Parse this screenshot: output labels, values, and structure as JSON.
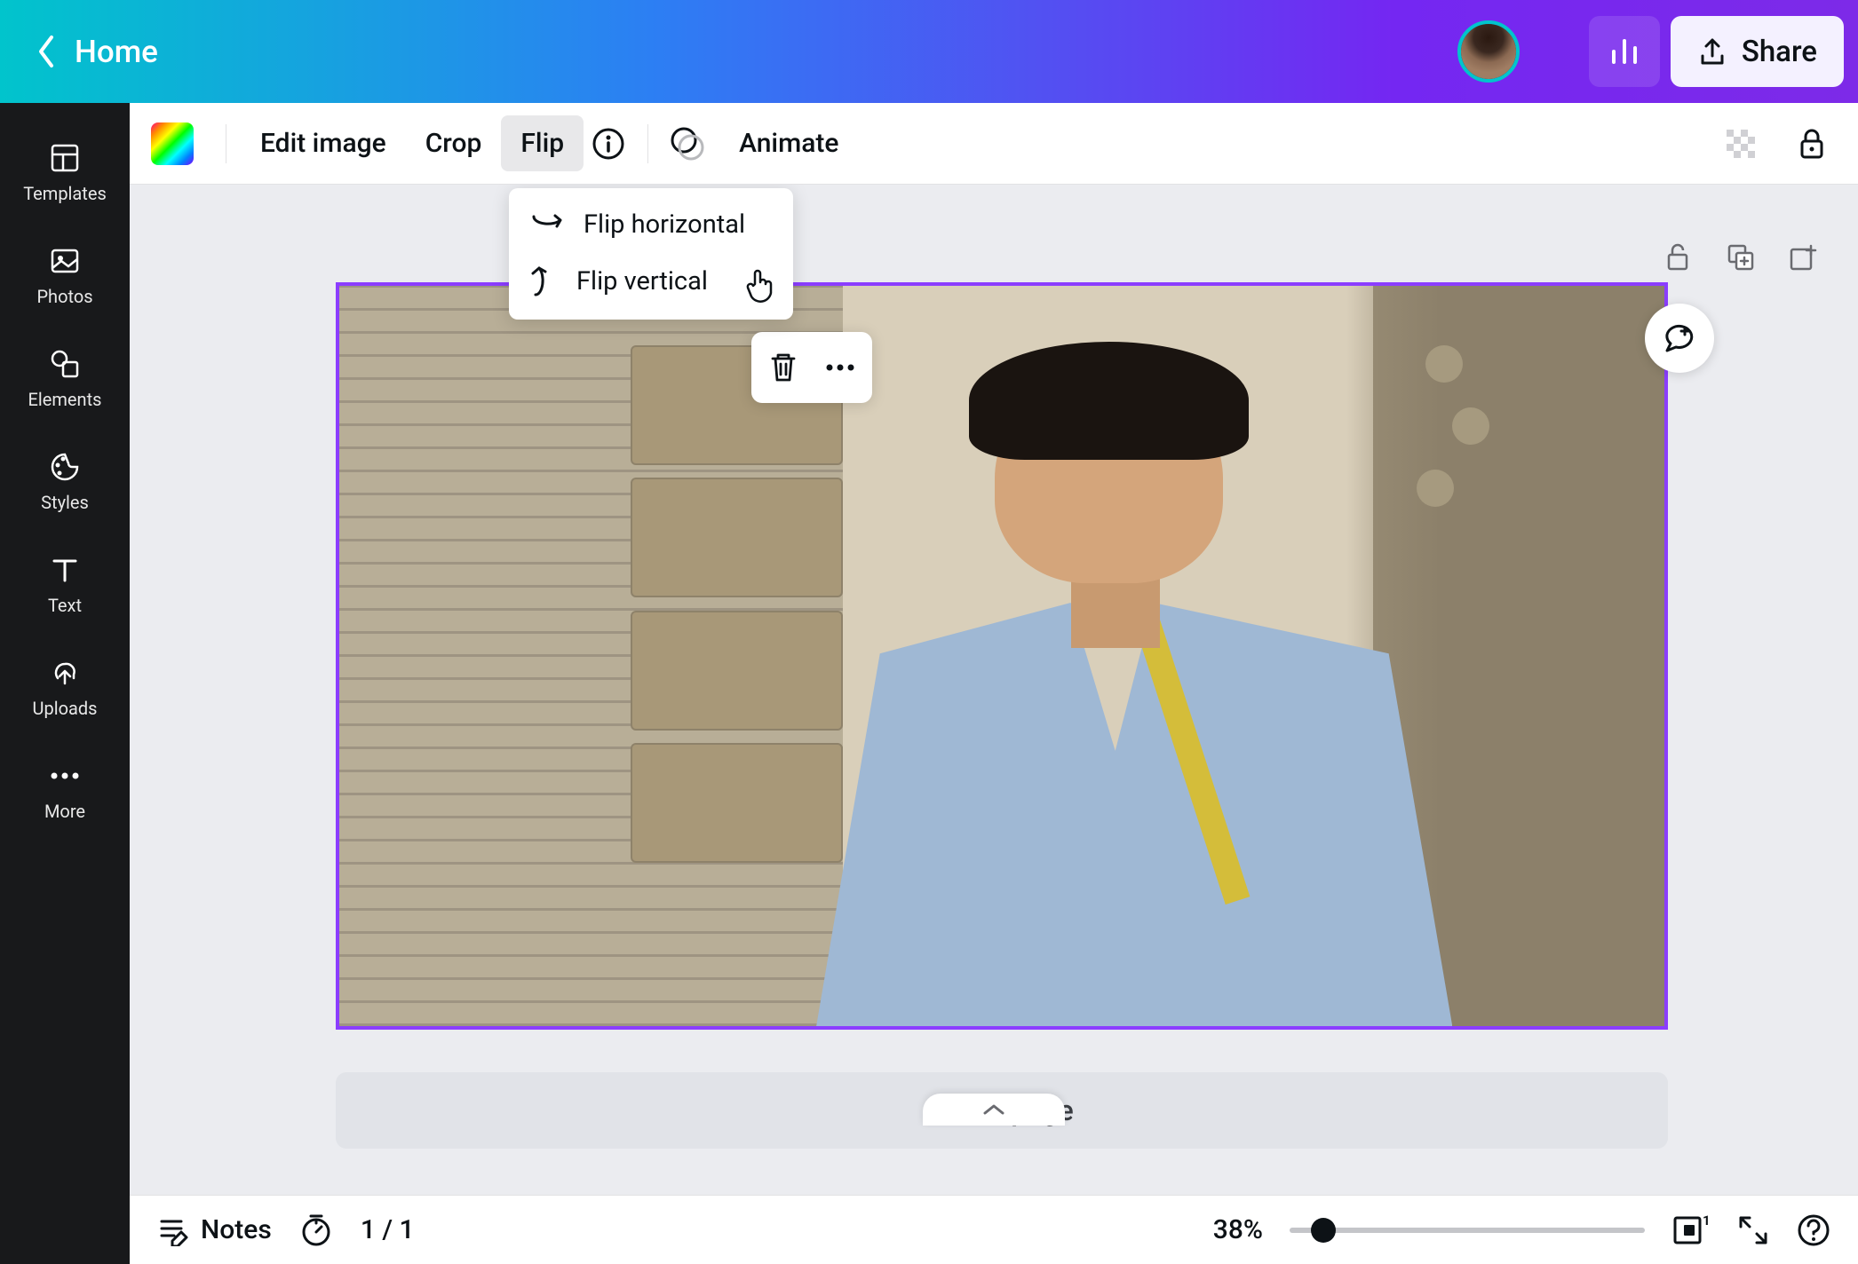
{
  "header": {
    "home_label": "Home",
    "share_label": "Share"
  },
  "sidebar": {
    "items": [
      {
        "label": "Templates"
      },
      {
        "label": "Photos"
      },
      {
        "label": "Elements"
      },
      {
        "label": "Styles"
      },
      {
        "label": "Text"
      },
      {
        "label": "Uploads"
      },
      {
        "label": "More"
      }
    ]
  },
  "toolbar": {
    "edit_image_label": "Edit image",
    "crop_label": "Crop",
    "flip_label": "Flip",
    "animate_label": "Animate"
  },
  "flip_menu": {
    "horizontal_label": "Flip horizontal",
    "vertical_label": "Flip vertical"
  },
  "canvas": {
    "add_page_label": "+ Add page"
  },
  "bottombar": {
    "notes_label": "Notes",
    "page_indicator": "1 / 1",
    "zoom_pct": "38%",
    "pages_badge": "1"
  },
  "colors": {
    "accent": "#8b3dff"
  }
}
